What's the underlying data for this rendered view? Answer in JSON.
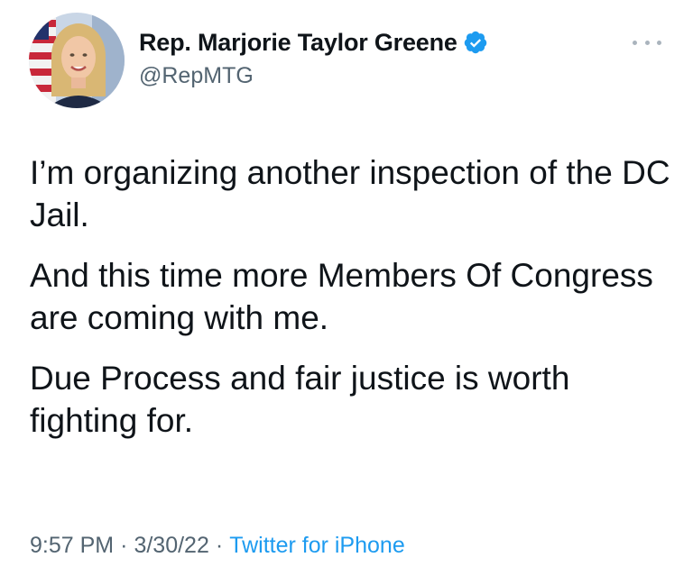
{
  "author": {
    "display_name": "Rep. Marjorie Taylor Greene",
    "handle": "@RepMTG",
    "verified": true,
    "verified_icon": "verified-badge-icon",
    "avatar_icon": "profile-photo"
  },
  "tweet": {
    "paragraphs": [
      "I’m organizing another inspection of the DC Jail.",
      "And this time more Members Of Congress are coming with me.",
      "Due Process and fair justice is worth fighting for."
    ],
    "time": "9:57 PM",
    "date": "3/30/22",
    "separator": "·",
    "source": "Twitter for iPhone"
  },
  "colors": {
    "text": "#0f1419",
    "secondary": "#536471",
    "accent": "#1d9bf0"
  }
}
